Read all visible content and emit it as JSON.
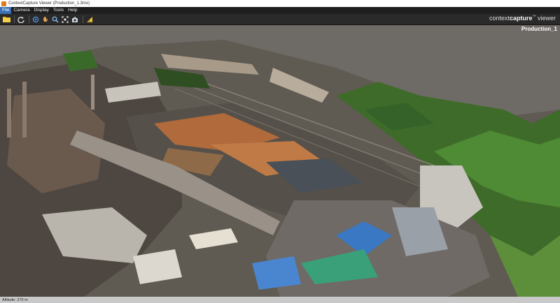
{
  "window": {
    "title": "ContextCapture Viewer (Production_1.3mx)"
  },
  "menu": [
    {
      "label": "File",
      "active": true
    },
    {
      "label": "Camera"
    },
    {
      "label": "Display"
    },
    {
      "label": "Tools"
    },
    {
      "label": "Help"
    }
  ],
  "toolbar": {
    "icons": [
      "open-folder-icon",
      "refresh-icon",
      "rotate-icon",
      "pan-hand-icon",
      "zoom-icon",
      "fit-view-icon",
      "capture-icon",
      "measure-icon"
    ]
  },
  "brand": {
    "prefix": "context",
    "highlight": "capture",
    "trademark": "™",
    "suffix": " viewer"
  },
  "viewport": {
    "scene_name": "Production_1"
  },
  "status": {
    "left": "Altitude: 270 m"
  },
  "colors": {
    "menubar": "#1e1e1e",
    "active_menu": "#3a6fb5",
    "sky": "#6e6a66",
    "vegetation": "#3f6b2a",
    "ore": "#b06a3b"
  }
}
